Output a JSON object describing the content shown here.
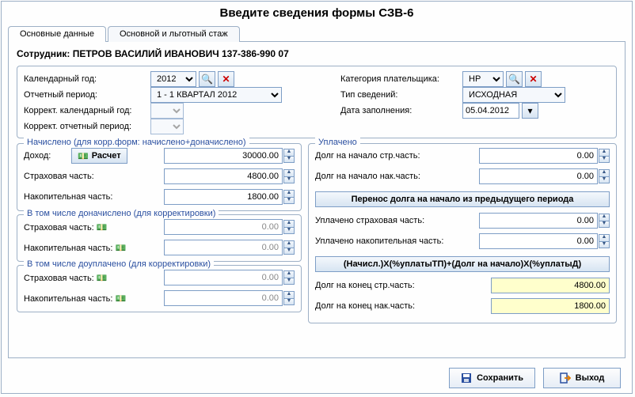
{
  "title": "Введите сведения формы СЗВ-6",
  "tabs": {
    "main": "Основные данные",
    "stazh": "Основной и льготный стаж"
  },
  "employee_label": "Сотрудник:",
  "employee_value": "ПЕТРОВ ВАСИЛИЙ ИВАНОВИЧ 137-386-990 07",
  "top": {
    "year_label": "Календарный год:",
    "year_value": "2012",
    "period_label": "Отчетный период:",
    "period_value": "1 - 1 КВАРТАЛ 2012",
    "corr_year_label": "Коррект. календарный год:",
    "corr_year_value": "",
    "corr_period_label": "Коррект. отчетный период:",
    "corr_period_value": "",
    "cat_label": "Категория плательщика:",
    "cat_value": "НР",
    "type_label": "Тип сведений:",
    "type_value": "ИСХОДНАЯ",
    "date_label": "Дата заполнения:",
    "date_value": "05.04.2012"
  },
  "accrued": {
    "title": "Начислено (для корр.форм: начислено+доначислено)",
    "income_label": "Доход:",
    "calc_label": "Расчет",
    "income_value": "30000.00",
    "ins_label": "Страховая часть:",
    "ins_value": "4800.00",
    "acc_label": "Накопительная часть:",
    "acc_value": "1800.00"
  },
  "addacc": {
    "title": "В том числе доначислено (для корректировки)",
    "ins_label": "Страховая часть:",
    "ins_value": "0.00",
    "acc_label": "Накопительная часть:",
    "acc_value": "0.00"
  },
  "addpaid": {
    "title": "В том числе доуплачено (для корректировки)",
    "ins_label": "Страховая часть:",
    "ins_value": "0.00",
    "acc_label": "Накопительная часть:",
    "acc_value": "0.00"
  },
  "paid": {
    "title": "Уплачено",
    "debt_start_ins_label": "Долг на начало стр.часть:",
    "debt_start_ins_value": "0.00",
    "debt_start_acc_label": "Долг на начало нак.часть:",
    "debt_start_acc_value": "0.00",
    "transfer_btn": "Перенос долга на начало из предыдущего периода",
    "paid_ins_label": "Уплачено страховая часть:",
    "paid_ins_value": "0.00",
    "paid_acc_label": "Уплачено накопительная часть:",
    "paid_acc_value": "0.00",
    "formula_btn": "(Начисл.)X(%уплатыТП)+(Долг на начало)X(%уплатыД)",
    "debt_end_ins_label": "Долг на конец стр.часть:",
    "debt_end_ins_value": "4800.00",
    "debt_end_acc_label": "Долг на конец нак.часть:",
    "debt_end_acc_value": "1800.00"
  },
  "footer": {
    "save": "Сохранить",
    "exit": "Выход"
  }
}
